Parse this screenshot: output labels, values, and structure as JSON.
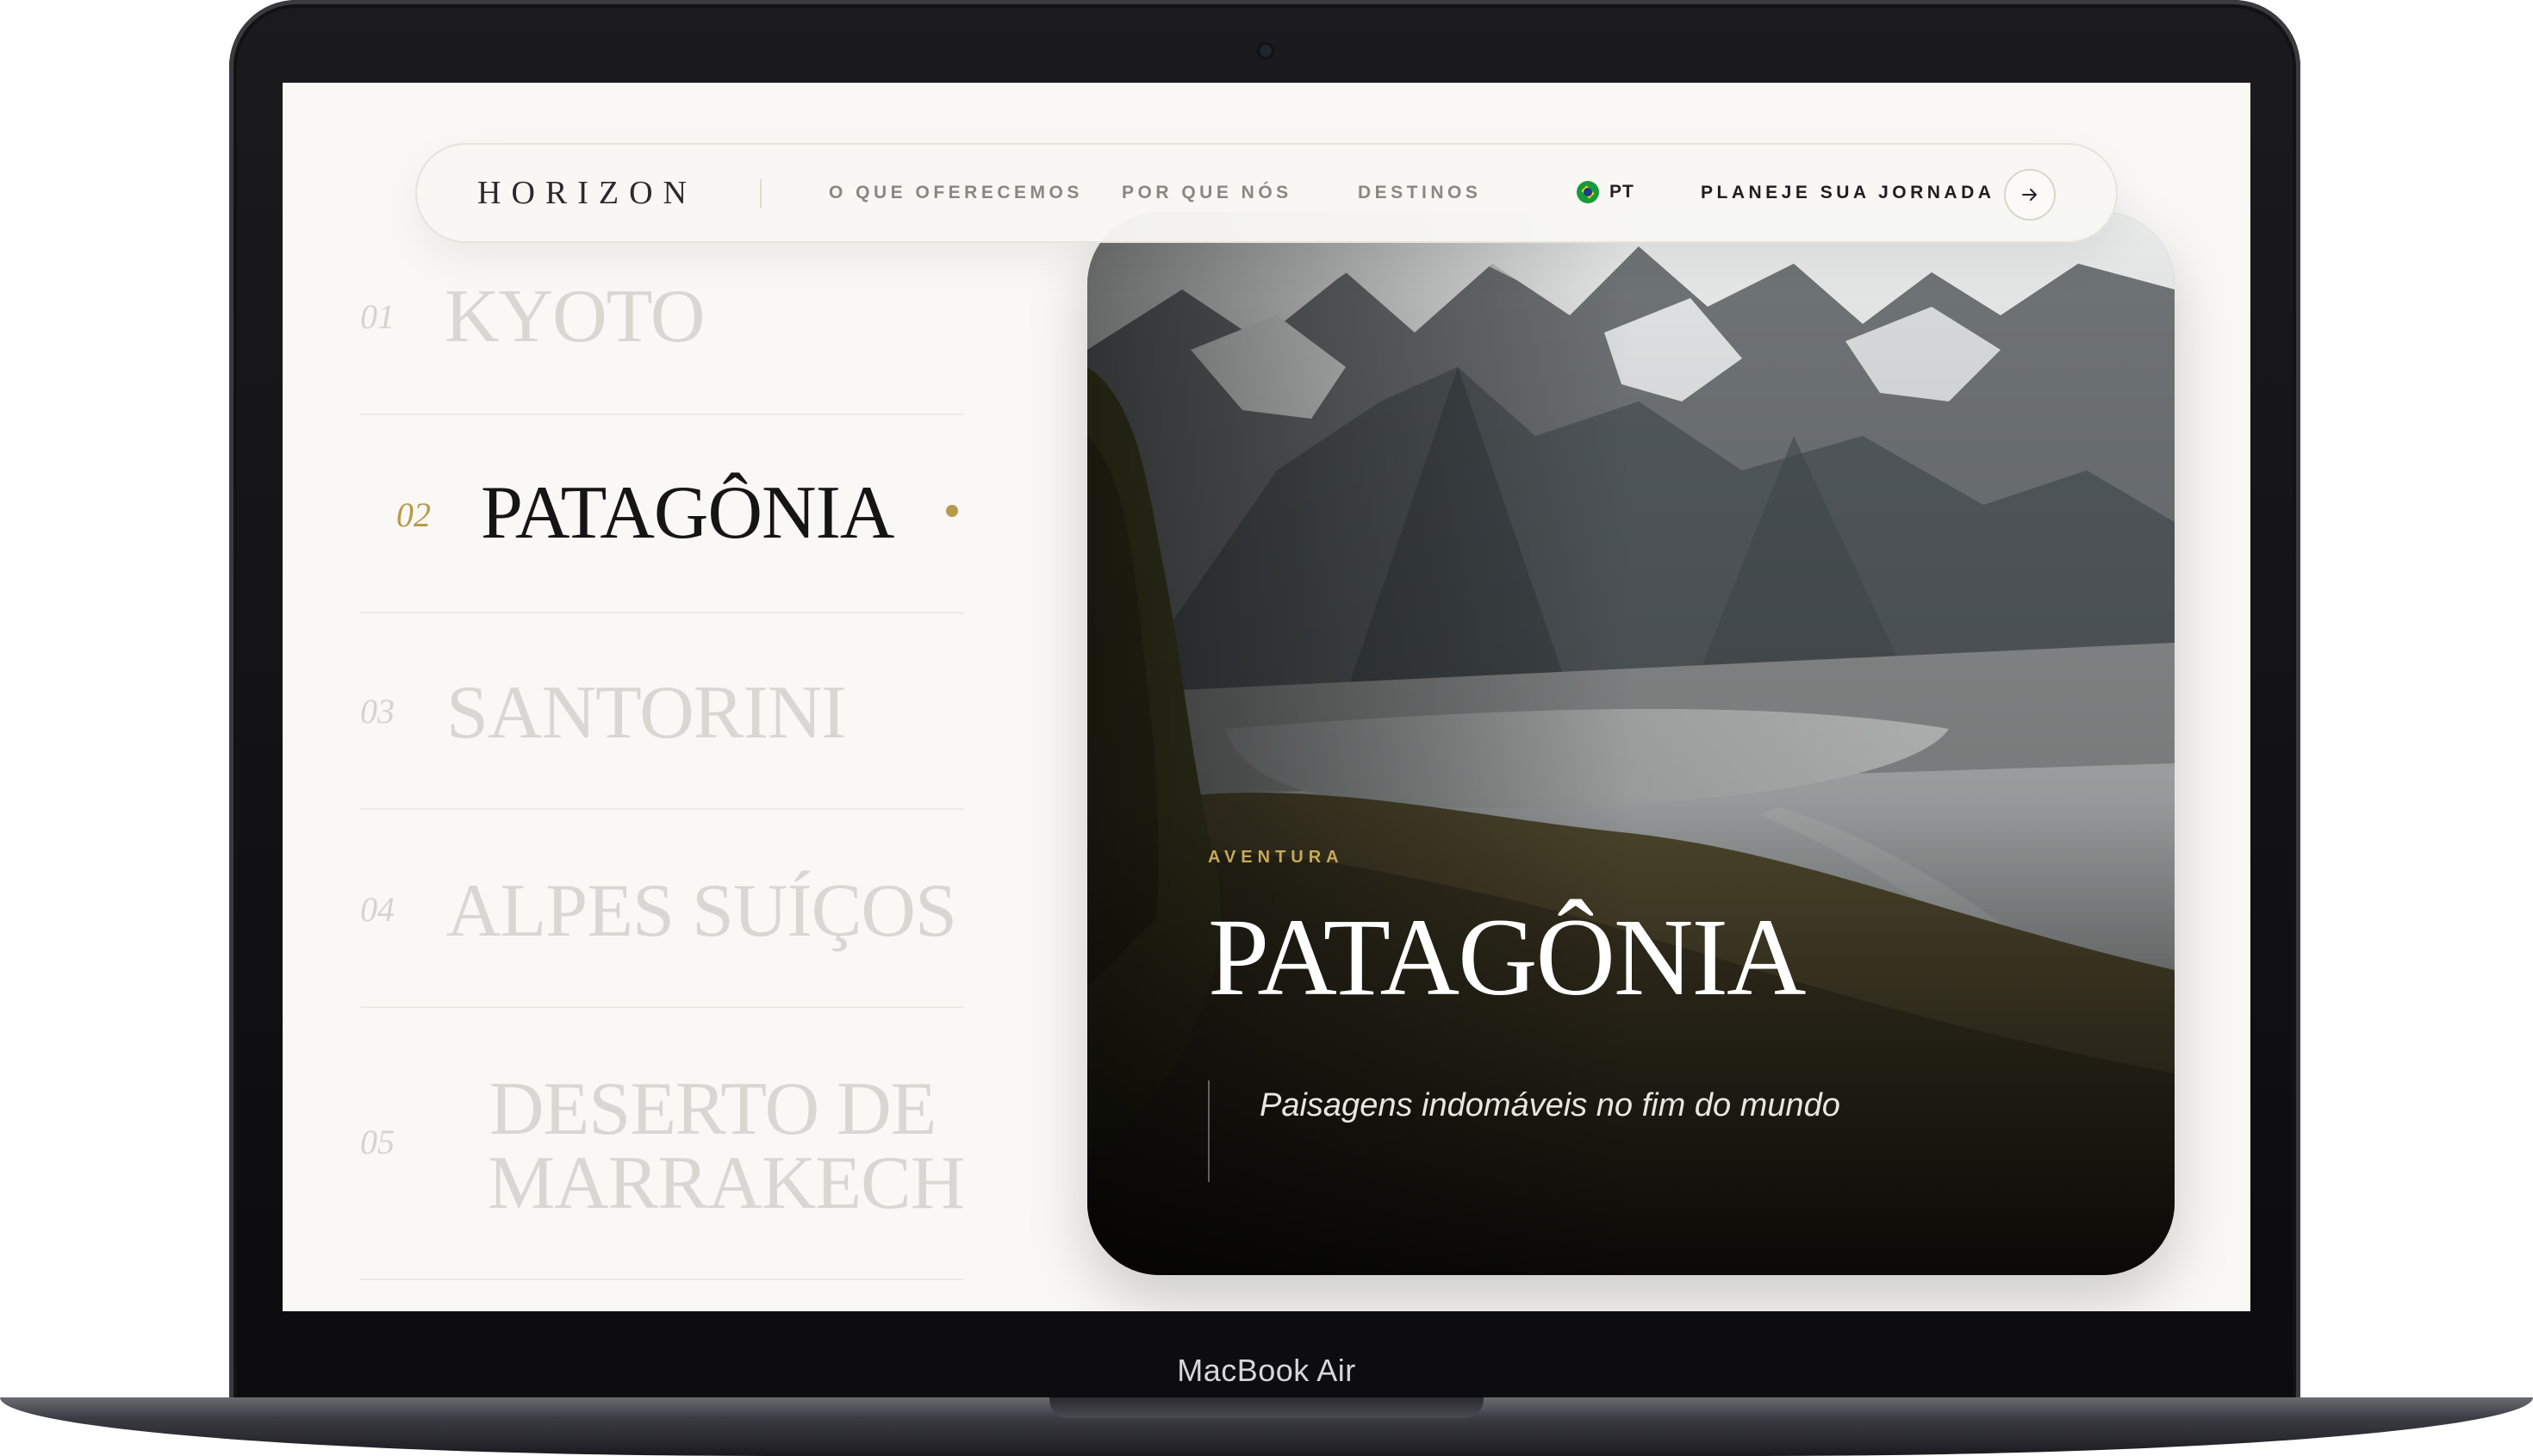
{
  "device": {
    "model_label": "MacBook Air"
  },
  "nav": {
    "logo": "HORIZON",
    "links": [
      "O QUE OFERECEMOS",
      "POR QUE NÓS",
      "DESTINOS"
    ],
    "language": {
      "code": "PT",
      "icon": "brazil-flag-icon"
    },
    "cta_label": "PLANEJE SUA JORNADA",
    "cta_icon": "arrow-right-icon"
  },
  "destinations": [
    {
      "number": "01",
      "name": "KYOTO",
      "active": false
    },
    {
      "number": "02",
      "name": "PATAGÔNIA",
      "active": true
    },
    {
      "number": "03",
      "name": "SANTORINI",
      "active": false
    },
    {
      "number": "04",
      "name": "ALPES SUÍÇOS",
      "active": false
    },
    {
      "number": "05",
      "name": "DESERTO DE MARRAKECH",
      "lines": [
        "DESERTO DE",
        "MARRAKECH"
      ],
      "active": false
    }
  ],
  "hero": {
    "category": "AVENTURA",
    "title": "PATAGÔNIA",
    "subtitle": "Paisagens indomáveis no fim do mundo"
  },
  "colors": {
    "accent_gold": "#b89a4e",
    "eyebrow_gold": "#c9a85a",
    "page_background": "#f9f8f5",
    "active_text": "#151515",
    "inactive_text": "#d9d7d2"
  }
}
